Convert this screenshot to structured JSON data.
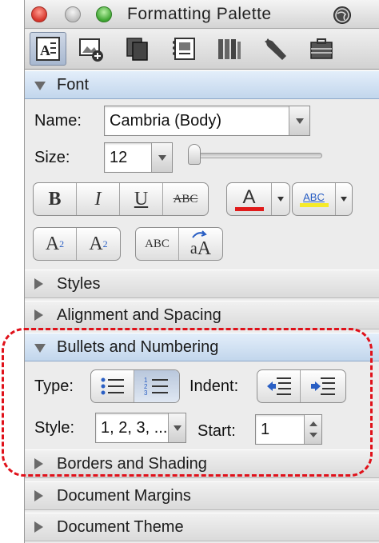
{
  "window": {
    "title": "Formatting Palette"
  },
  "toolbar": {
    "icons": [
      "text-format-icon",
      "insert-image-icon",
      "copy-icon",
      "scrapbook-icon",
      "reference-tools-icon",
      "compatibility-wrench-icon",
      "project-palette-icon"
    ]
  },
  "font": {
    "header": "Font",
    "name_label": "Name:",
    "name_value": "Cambria (Body)",
    "size_label": "Size:",
    "size_value": "12",
    "bold": "B",
    "italic": "I",
    "underline": "U",
    "strikethrough": "ABC",
    "font_color_glyph": "A",
    "font_color": "#e01b1b",
    "highlight_glyph": "ABC",
    "highlight_color": "#f5ea2a",
    "superscript": "A",
    "superscript_mark": "2",
    "subscript": "A",
    "subscript_mark": "2",
    "small_caps": "ABC",
    "change_case_big": "a",
    "change_case_small": "A"
  },
  "sections": {
    "styles": "Styles",
    "alignment": "Alignment and Spacing",
    "bullets": "Bullets and Numbering",
    "borders": "Borders and Shading",
    "margins": "Document Margins",
    "theme": "Document Theme"
  },
  "bullets": {
    "type_label": "Type:",
    "indent_label": "Indent:",
    "style_label": "Style:",
    "style_value": "1, 2, 3, ...",
    "start_label": "Start:",
    "start_value": "1"
  },
  "colors": {
    "highlight_box": "#e0111a",
    "accent": "#2a5fc4"
  }
}
